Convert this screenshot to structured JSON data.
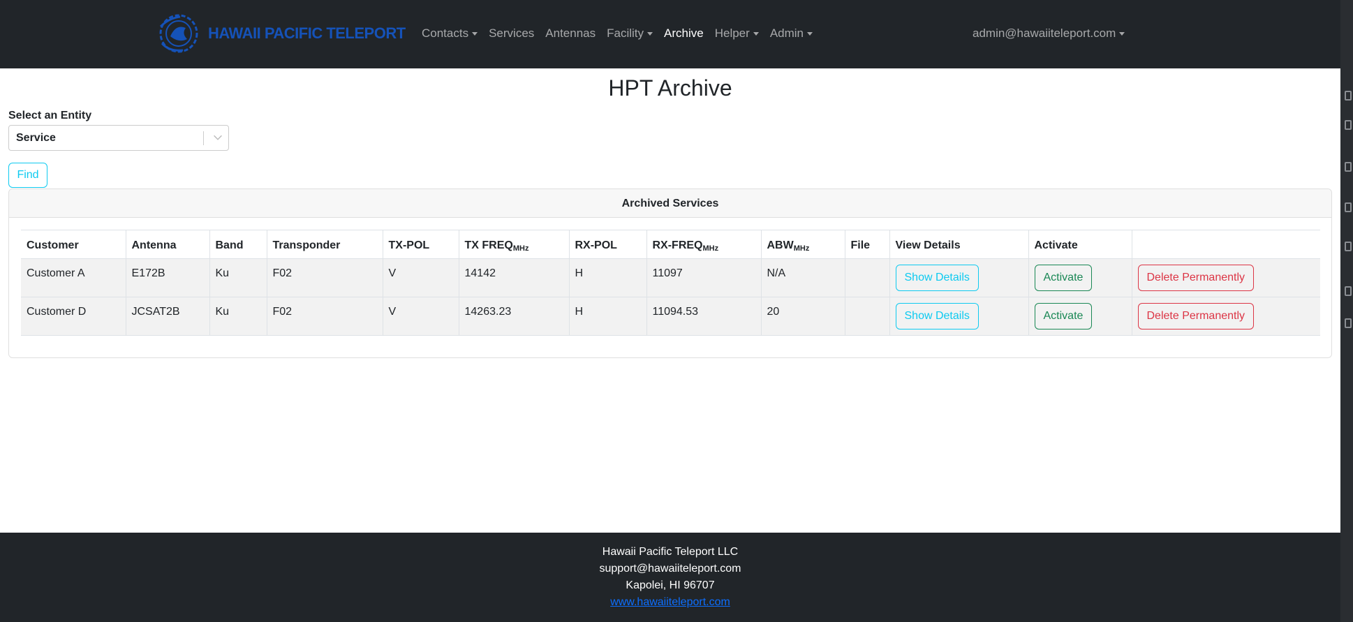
{
  "navbar": {
    "brand": "HAWAII PACIFIC TELEPORT",
    "items": [
      {
        "label": "Contacts",
        "dropdown": true,
        "active": false
      },
      {
        "label": "Services",
        "dropdown": false,
        "active": false
      },
      {
        "label": "Antennas",
        "dropdown": false,
        "active": false
      },
      {
        "label": "Facility",
        "dropdown": true,
        "active": false
      },
      {
        "label": "Archive",
        "dropdown": false,
        "active": true
      },
      {
        "label": "Helper",
        "dropdown": true,
        "active": false
      },
      {
        "label": "Admin",
        "dropdown": true,
        "active": false
      }
    ],
    "user": "admin@hawaiiteleport.com"
  },
  "page": {
    "title": "HPT Archive",
    "entity_label": "Select an Entity",
    "entity_value": "Service",
    "find_label": "Find"
  },
  "card": {
    "header": "Archived Services",
    "columns": [
      {
        "label": "Customer",
        "unit": ""
      },
      {
        "label": "Antenna",
        "unit": ""
      },
      {
        "label": "Band",
        "unit": ""
      },
      {
        "label": "Transponder",
        "unit": ""
      },
      {
        "label": "TX-POL",
        "unit": ""
      },
      {
        "label": "TX FREQ",
        "unit": "MHz"
      },
      {
        "label": "RX-POL",
        "unit": ""
      },
      {
        "label": "RX-FREQ",
        "unit": "MHz"
      },
      {
        "label": "ABW",
        "unit": "MHz"
      },
      {
        "label": "File",
        "unit": ""
      },
      {
        "label": "View Details",
        "unit": ""
      },
      {
        "label": "Activate",
        "unit": ""
      },
      {
        "label": "",
        "unit": ""
      }
    ],
    "rows": [
      {
        "customer": "Customer A",
        "antenna": "E172B",
        "band": "Ku",
        "transponder": "F02",
        "tx_pol": "V",
        "tx_freq": "14142",
        "rx_pol": "H",
        "rx_freq": "11097",
        "abw": "N/A",
        "file": ""
      },
      {
        "customer": "Customer D",
        "antenna": "JCSAT2B",
        "band": "Ku",
        "transponder": "F02",
        "tx_pol": "V",
        "tx_freq": "14263.23",
        "rx_pol": "H",
        "rx_freq": "11094.53",
        "abw": "20",
        "file": ""
      }
    ],
    "buttons": {
      "show_details": "Show Details",
      "activate": "Activate",
      "delete": "Delete Permanently"
    }
  },
  "footer": {
    "company": "Hawaii Pacific Teleport LLC",
    "email": "support@hawaiiteleport.com",
    "address": "Kapolei, HI 96707",
    "website": "www.hawaiiteleport.com"
  },
  "colors": {
    "navbar_bg": "#212529",
    "brand_blue": "#1552b8",
    "info": "#0dcaf0",
    "success": "#198754",
    "danger": "#dc3545",
    "link": "#0d6efd"
  }
}
